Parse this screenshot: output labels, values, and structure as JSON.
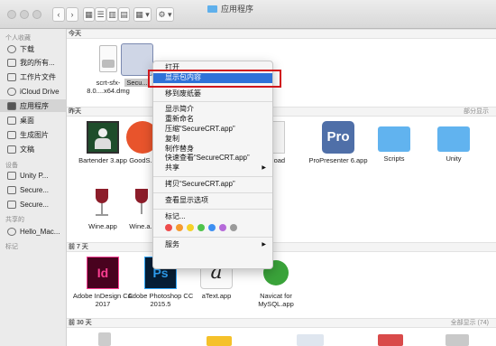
{
  "window": {
    "title": "应用程序"
  },
  "toolbar": {
    "view_icons": [
      "▦",
      "☰",
      "▥",
      "▤"
    ],
    "arrange": "▦ ▾",
    "action": "⚙ ▾"
  },
  "sidebar": {
    "favorites_header": "个人收藏",
    "items": [
      {
        "label": "下载",
        "icon": "download-icon"
      },
      {
        "label": "我的所有...",
        "icon": "all-files-icon"
      },
      {
        "label": "工作片文件",
        "icon": "documents-icon"
      },
      {
        "label": "iCloud Drive",
        "icon": "cloud-icon"
      },
      {
        "label": "应用程序",
        "icon": "applications-icon"
      },
      {
        "label": "桌面",
        "icon": "desktop-icon"
      },
      {
        "label": "生成图片",
        "icon": "folder-icon"
      },
      {
        "label": "文稿",
        "icon": "documents-icon"
      }
    ],
    "devices_header": "设备",
    "devices": [
      "Unity P...",
      "Secure...",
      "Secure..."
    ],
    "shared_header": "共享的",
    "shared": [
      "Hello_Mac..."
    ],
    "tags_header": "标记"
  },
  "sections": {
    "today": "今天",
    "yesterday": "昨天",
    "yesterday_right": "部分显示",
    "last7": "前 7 天",
    "last30": "前 30 天",
    "last30_right": "全部显示 (74)"
  },
  "files_today": [
    {
      "label": "scrt-sfx-8.0....x64.dmg"
    },
    {
      "label": "Secu..."
    }
  ],
  "files_yesterday": [
    {
      "label": "Bartender 3.app"
    },
    {
      "label": "GoodS..."
    },
    {
      "label": "load"
    },
    {
      "label": "ProPresenter 6.app"
    },
    {
      "label": "Scripts"
    },
    {
      "label": "Unity"
    }
  ],
  "files_yesterday2": [
    {
      "label": "Wine.app"
    },
    {
      "label": "Wine.a..."
    }
  ],
  "files_last7": [
    {
      "label": "Adobe InDesign CC 2017",
      "mark": "Id"
    },
    {
      "label": "Adobe Photoshop CC 2015.5",
      "mark": "Ps"
    },
    {
      "label": "aText.app",
      "mark": "a"
    },
    {
      "label": "Navicat for MySQL.app"
    }
  ],
  "context_menu": {
    "items": [
      {
        "label": "打开"
      },
      {
        "label": "显示包内容"
      },
      {
        "label": "移到废纸篓"
      },
      {
        "label": "显示简介"
      },
      {
        "label": "重新命名"
      },
      {
        "label": "压缩“SecureCRT.app”"
      },
      {
        "label": "复制"
      },
      {
        "label": "制作替身"
      },
      {
        "label": "快速查看“SecureCRT.app”"
      },
      {
        "label": "共享"
      },
      {
        "label": "拷贝“SecureCRT.app”"
      },
      {
        "label": "查看显示选项"
      },
      {
        "label": "标记..."
      },
      {
        "label": "服务"
      }
    ],
    "submenu_arrow": "▶",
    "tag_colors": [
      "#ee4c4c",
      "#f59a2f",
      "#f5d128",
      "#4fc44c",
      "#3d8ff2",
      "#b56ad9",
      "#9a9a9a"
    ]
  },
  "colors": {
    "highlight": "#2f72d8",
    "callout": "#d0161c",
    "folder": "#5fb0ec"
  }
}
